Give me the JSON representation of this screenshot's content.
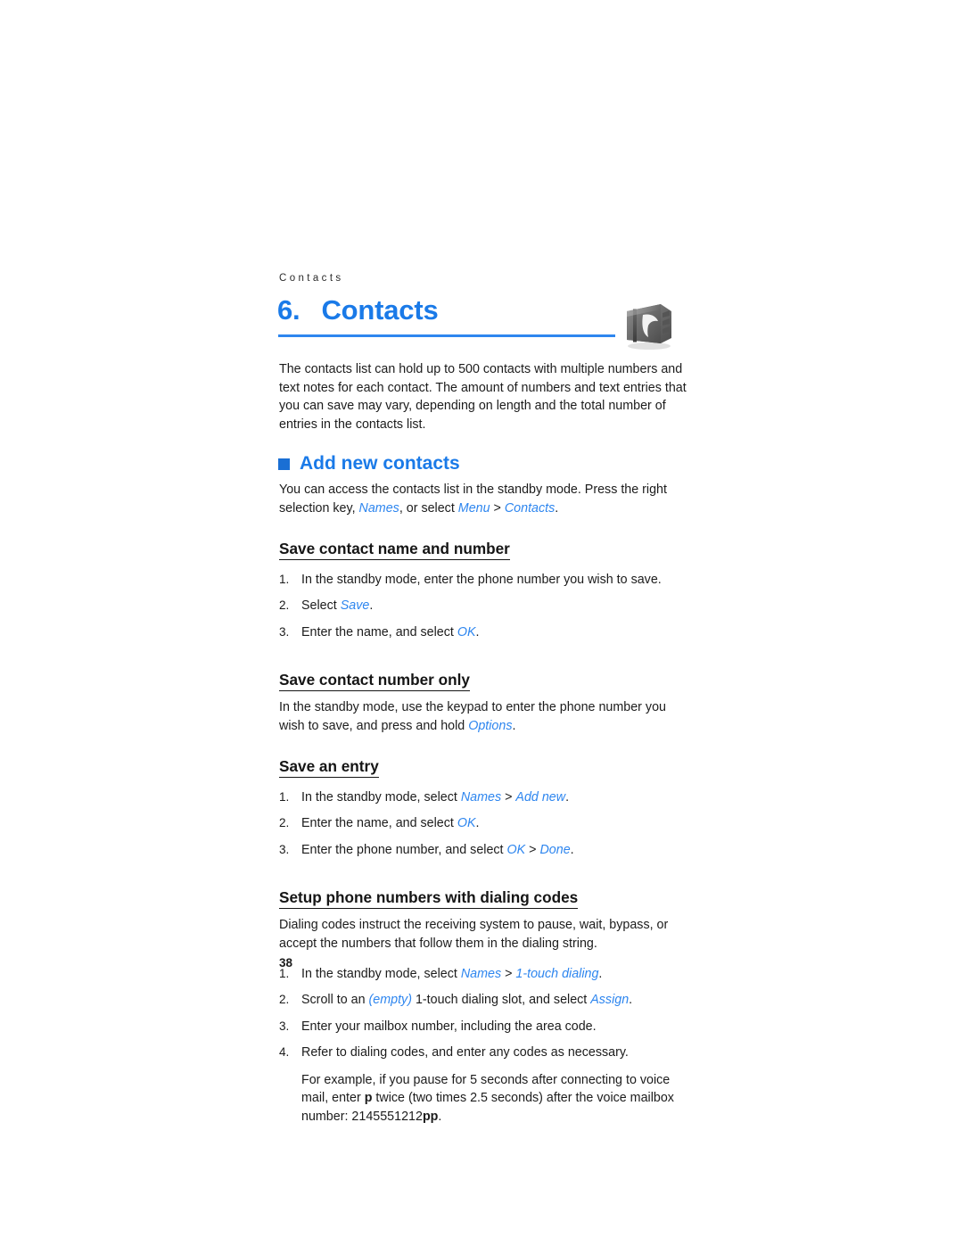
{
  "document": {
    "running_head": "Contacts",
    "chapter_number": "6.",
    "chapter_title": "Contacts",
    "page_number": "38",
    "icon": "contacts-book-icon",
    "accent_color": "#1a7ae8",
    "bullet_color": "#1a6fd4",
    "rule_color": "#2e86ef"
  },
  "intro": {
    "paragraph": "The contacts list can hold up to 500 contacts with multiple numbers and text notes for each contact. The amount of numbers and text entries that you can save may vary, depending on length and the total number of entries in the contacts list."
  },
  "section": {
    "heading": "Add new contacts",
    "intro_a": "You can access the contacts list in the standby mode. Press the right selection key, ",
    "intro_b": "Names",
    "intro_c": ", or select ",
    "intro_d": "Menu",
    "intro_e": " > ",
    "intro_f": "Contacts",
    "intro_g": "."
  },
  "sub1": {
    "heading": "Save contact name and number",
    "steps": [
      {
        "marker": "1.",
        "a": "In the standby mode, enter the phone number you wish to save.",
        "ui1": "",
        "b": "",
        "ui2": "",
        "c": ""
      },
      {
        "marker": "2.",
        "a": "Select ",
        "ui1": "Save",
        "b": ".",
        "ui2": "",
        "c": ""
      },
      {
        "marker": "3.",
        "a": "Enter the name, and select ",
        "ui1": "OK",
        "b": ".",
        "ui2": "",
        "c": ""
      }
    ]
  },
  "sub2": {
    "heading": "Save contact number only",
    "para_a": "In the standby mode, use the keypad to enter the phone number you wish to save, and press and hold ",
    "para_ui": "Options",
    "para_b": "."
  },
  "sub3": {
    "heading": "Save an entry",
    "steps": [
      {
        "marker": "1.",
        "a": "In the standby mode, select ",
        "ui1": "Names",
        "b": " > ",
        "ui2": "Add new",
        "c": "."
      },
      {
        "marker": "2.",
        "a": "Enter the name, and select ",
        "ui1": "OK",
        "b": ".",
        "ui2": "",
        "c": ""
      },
      {
        "marker": "3.",
        "a": "Enter the phone number, and select ",
        "ui1": "OK",
        "b": " > ",
        "ui2": "Done",
        "c": "."
      }
    ]
  },
  "sub4": {
    "heading": "Setup phone numbers with dialing codes",
    "para": "Dialing codes instruct the receiving system to pause, wait, bypass, or accept the numbers that follow them in the dialing string.",
    "steps": [
      {
        "marker": "1.",
        "a": "In the standby mode, select ",
        "ui1": "Names",
        "b": " > ",
        "ui2": "1-touch dialing",
        "c": "."
      },
      {
        "marker": "2.",
        "a": "Scroll to an ",
        "ui1": "(empty)",
        "b": " 1-touch dialing slot, and select ",
        "ui2": "Assign",
        "c": "."
      },
      {
        "marker": "3.",
        "a": "Enter your mailbox number, including the area code.",
        "ui1": "",
        "b": "",
        "ui2": "",
        "c": ""
      },
      {
        "marker": "4.",
        "a": "Refer to dialing codes, and enter any codes as necessary.",
        "ui1": "",
        "b": "",
        "ui2": "",
        "c": ""
      }
    ],
    "example_a": "For example, if you pause for 5 seconds after connecting to voice mail, enter ",
    "example_p": "p",
    "example_b": " twice (two times 2.5 seconds) after the voice mailbox number: 2145551212",
    "example_pp": "pp",
    "example_c": "."
  }
}
